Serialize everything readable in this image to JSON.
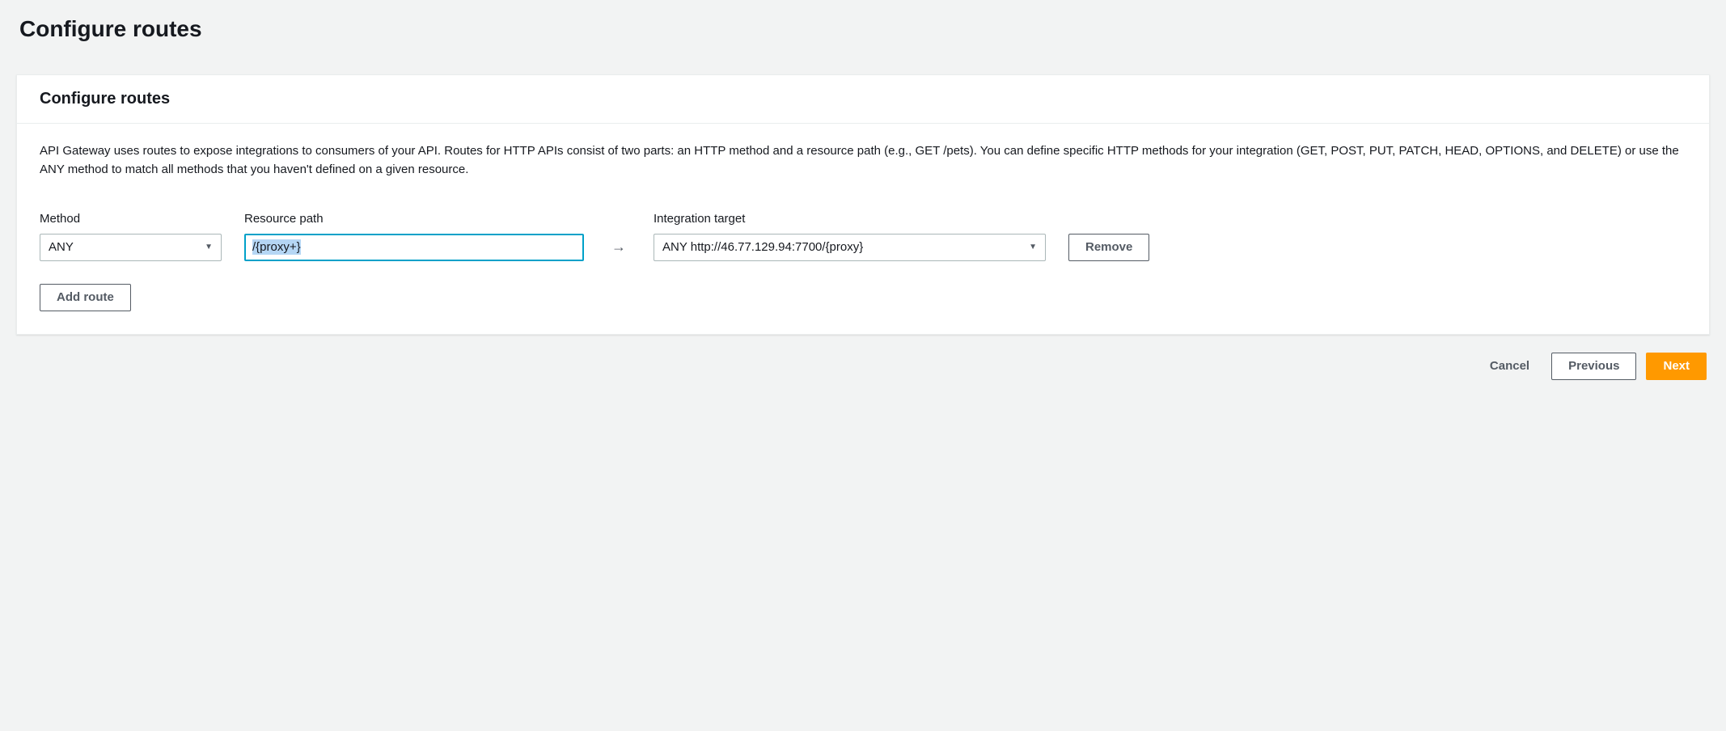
{
  "page": {
    "title": "Configure routes"
  },
  "panel": {
    "title": "Configure routes",
    "description": "API Gateway uses routes to expose integrations to consumers of your API. Routes for HTTP APIs consist of two parts: an HTTP method and a resource path (e.g., GET /pets). You can define specific HTTP methods for your integration (GET, POST, PUT, PATCH, HEAD, OPTIONS, and DELETE) or use the ANY method to match all methods that you haven't defined on a given resource."
  },
  "labels": {
    "method": "Method",
    "resource_path": "Resource path",
    "integration_target": "Integration target"
  },
  "route": {
    "method": "ANY",
    "path": "/{proxy+}",
    "arrow": "→",
    "target": "ANY http://46.77.129.94:7700/{proxy}",
    "remove_label": "Remove"
  },
  "buttons": {
    "add_route": "Add route",
    "cancel": "Cancel",
    "previous": "Previous",
    "next": "Next"
  }
}
